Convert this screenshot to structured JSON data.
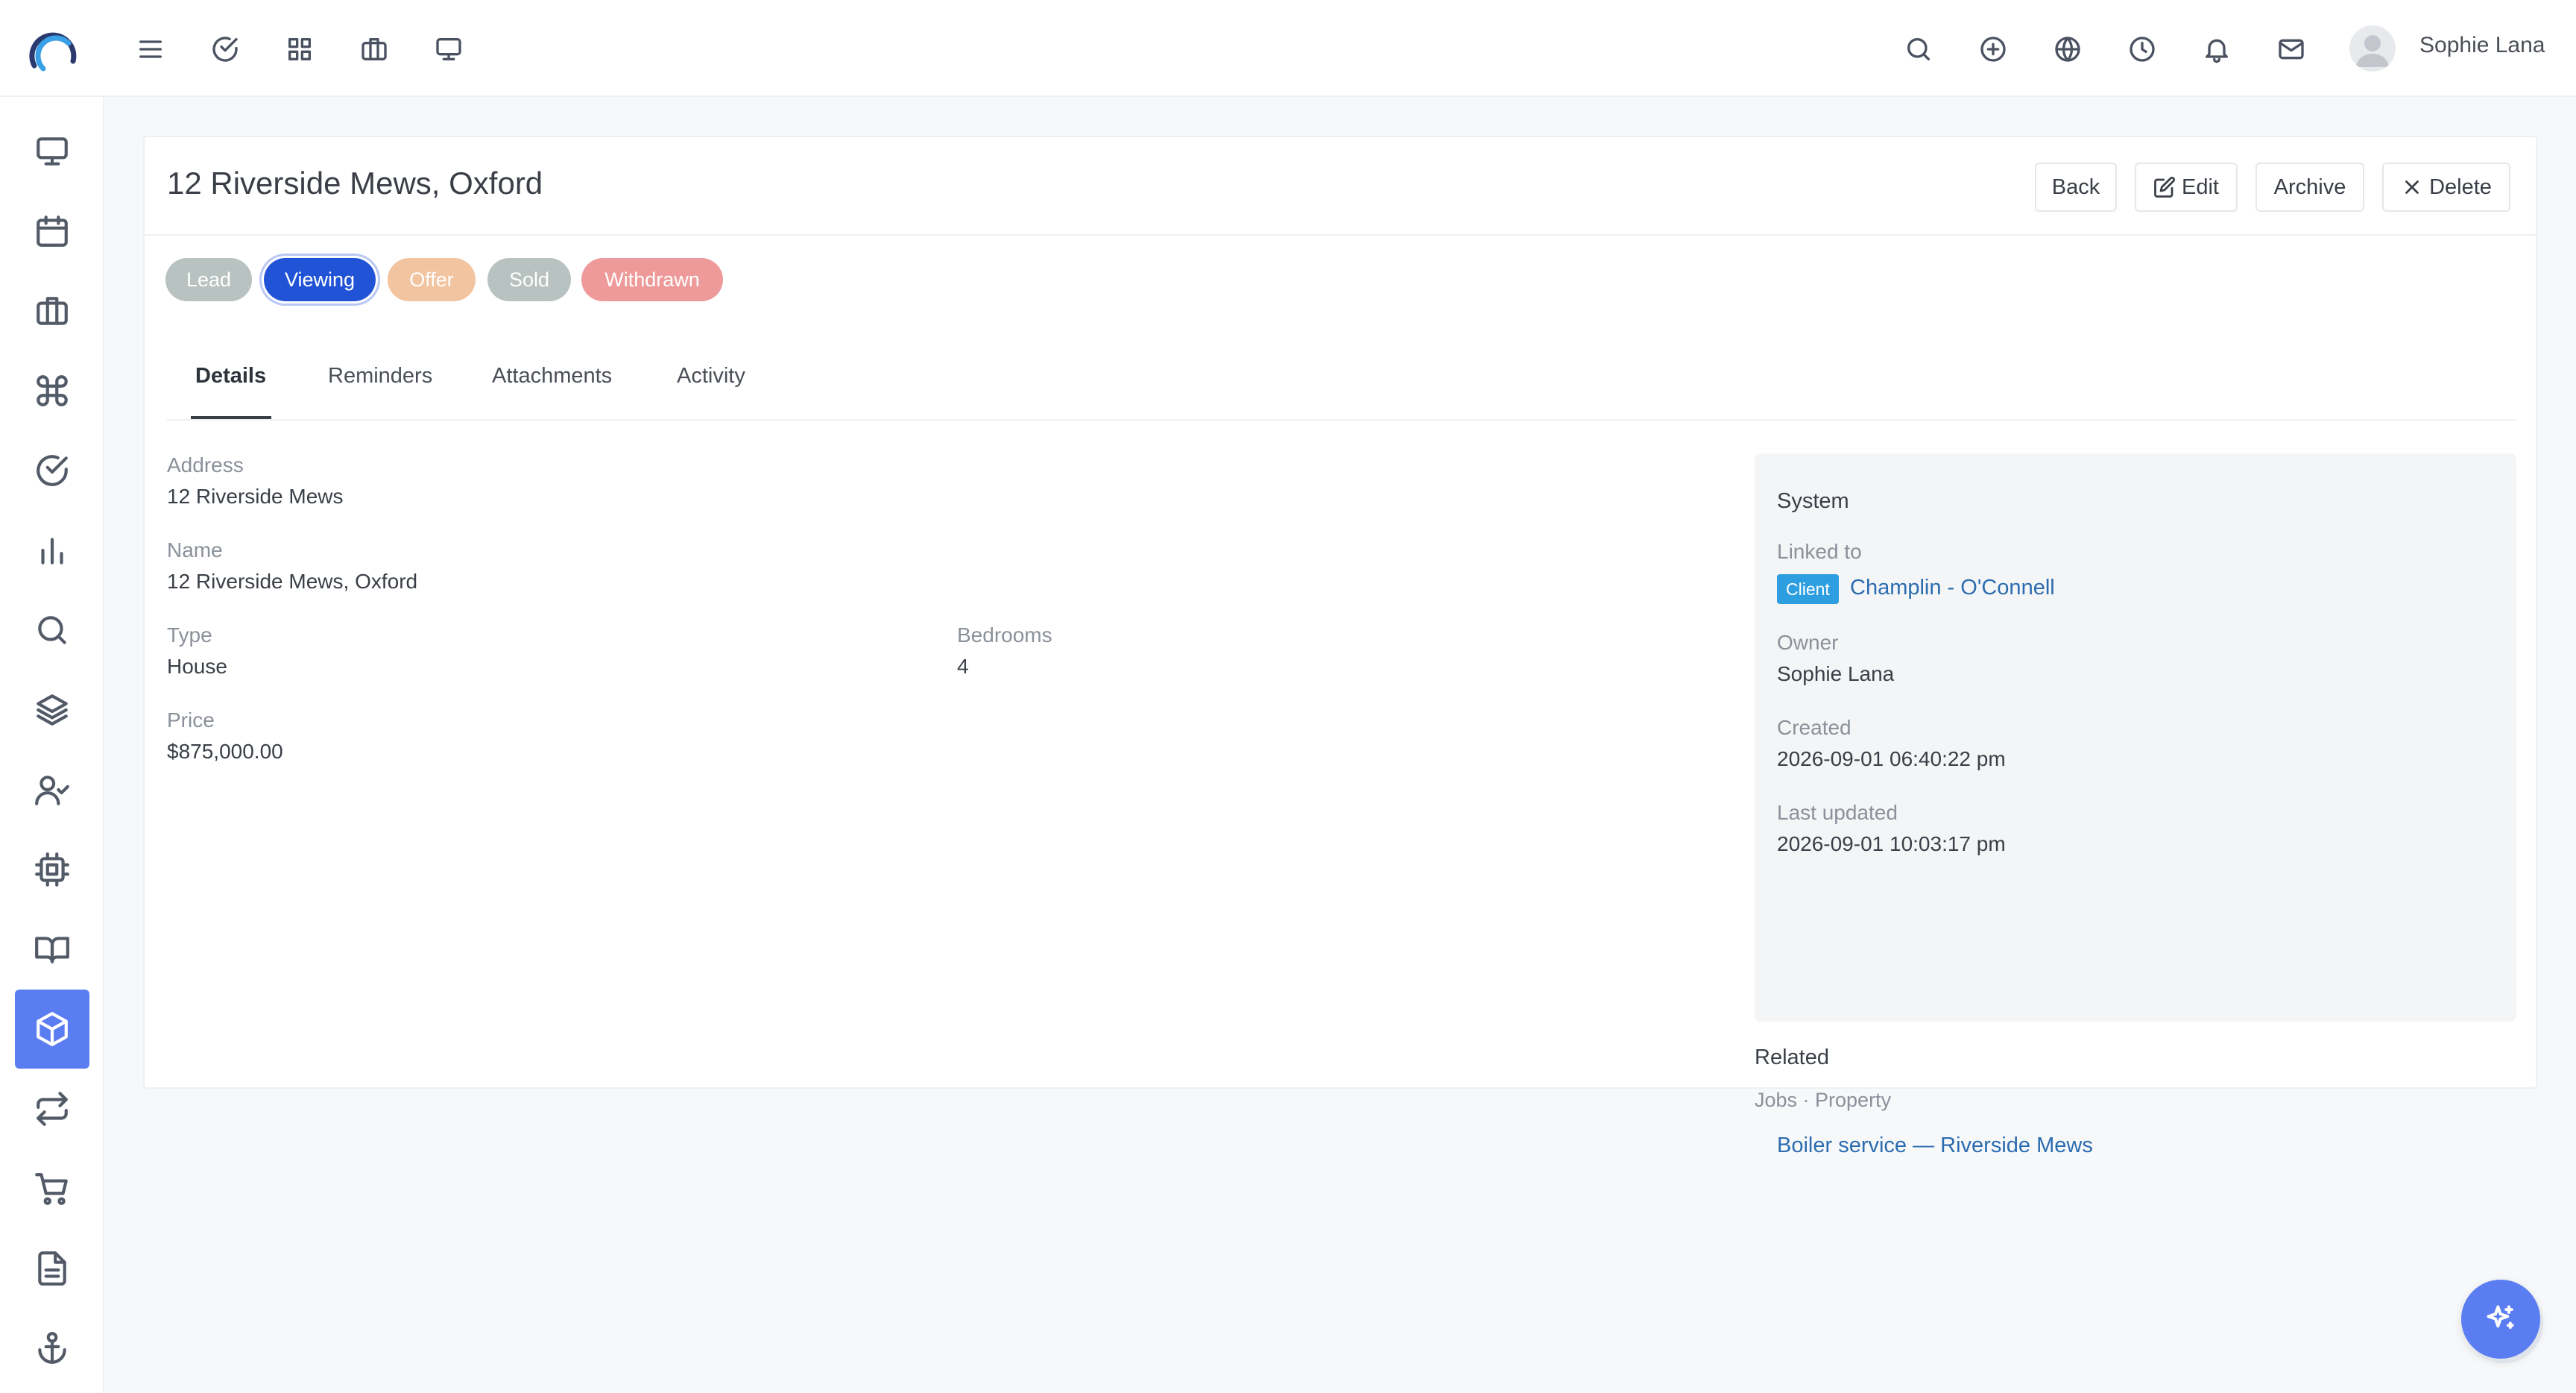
{
  "app": {
    "user_name": "Sophie Lana"
  },
  "topbar": {
    "left_icons": [
      "menu-icon",
      "check-circle-icon",
      "grid-icon",
      "briefcase-icon",
      "monitor-icon"
    ],
    "right_icons": [
      "search-icon",
      "plus-circle-icon",
      "globe-icon",
      "clock-icon",
      "bell-icon",
      "mail-icon"
    ]
  },
  "sidebar": {
    "items": [
      {
        "icon": "monitor-icon",
        "active": false
      },
      {
        "icon": "calendar-icon",
        "active": false
      },
      {
        "icon": "briefcase-icon",
        "active": false
      },
      {
        "icon": "command-icon",
        "active": false
      },
      {
        "icon": "check-circle-icon",
        "active": false
      },
      {
        "icon": "bar-chart-icon",
        "active": false
      },
      {
        "icon": "search-icon",
        "active": false
      },
      {
        "icon": "layers-icon",
        "active": false
      },
      {
        "icon": "user-check-icon",
        "active": false
      },
      {
        "icon": "cpu-icon",
        "active": false
      },
      {
        "icon": "book-open-icon",
        "active": false
      },
      {
        "icon": "package-icon",
        "active": true
      },
      {
        "icon": "repeat-icon",
        "active": false
      },
      {
        "icon": "shopping-cart-icon",
        "active": false
      },
      {
        "icon": "file-text-icon",
        "active": false
      },
      {
        "icon": "anchor-icon",
        "active": false
      }
    ]
  },
  "header": {
    "title": "12 Riverside Mews, Oxford",
    "back_label": "Back",
    "edit_label": "Edit",
    "archive_label": "Archive",
    "delete_label": "Delete"
  },
  "stages": [
    {
      "label": "Lead",
      "color": "#b8c2c0",
      "active": false
    },
    {
      "label": "Viewing",
      "color": "#2153d6",
      "active": true
    },
    {
      "label": "Offer",
      "color": "#f2c4a0",
      "active": false
    },
    {
      "label": "Sold",
      "color": "#b8c2c0",
      "active": false
    },
    {
      "label": "Withdrawn",
      "color": "#ee9a9a",
      "active": false
    }
  ],
  "tabs": [
    {
      "label": "Details",
      "active": true
    },
    {
      "label": "Reminders",
      "active": false
    },
    {
      "label": "Attachments",
      "active": false
    },
    {
      "label": "Activity",
      "active": false
    }
  ],
  "details": {
    "address": {
      "label": "Address",
      "value": "12 Riverside Mews"
    },
    "name": {
      "label": "Name",
      "value": "12 Riverside Mews, Oxford"
    },
    "type": {
      "label": "Type",
      "value": "House"
    },
    "bedrooms": {
      "label": "Bedrooms",
      "value": "4"
    },
    "price": {
      "label": "Price",
      "value": "$875,000.00"
    }
  },
  "system": {
    "title": "System",
    "linked_to_label": "Linked to",
    "linked_badge": "Client",
    "linked_name": "Champlin - O'Connell",
    "owner_label": "Owner",
    "owner_value": "Sophie Lana",
    "created_label": "Created",
    "created_value": "2026-09-01 06:40:22 pm",
    "updated_label": "Last updated",
    "updated_value": "2026-09-01 10:03:17 pm"
  },
  "related": {
    "title": "Related",
    "subtitle": "Jobs · Property",
    "items": [
      "Boiler service — Riverside Mews"
    ]
  },
  "colors": {
    "accent": "#5b7df2",
    "link": "#2b6cb0",
    "client_badge": "#2d9ee0"
  }
}
